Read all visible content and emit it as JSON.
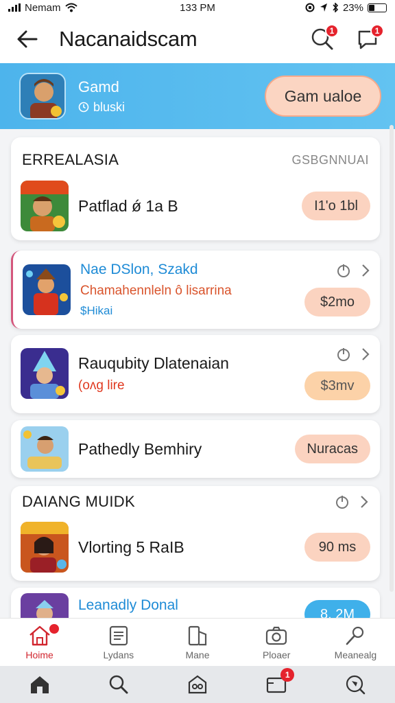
{
  "status": {
    "carrier": "Nemam",
    "time": "133 PM",
    "battery": "23%"
  },
  "header": {
    "title": "Nacanaidscam",
    "search_badge": "1",
    "notify_badge": "1"
  },
  "banner": {
    "title": "Gamd",
    "subtitle": "bluski",
    "button_label": "Gam ualoe"
  },
  "section1": {
    "title": "ERREALASIA",
    "right_label": "GSBGNNUAI"
  },
  "items": [
    {
      "title": "Patflad ǿ 1a B",
      "pill": "I1'o 1bl"
    },
    {
      "title": "Nae DSlon, Szakd",
      "subtitle": "Chamahennleln ô lisarrina",
      "meta": "$Hikai",
      "pill": "$2mo"
    },
    {
      "title": "Rauqubity Dlatenaian",
      "subtitle": "(oʌg lire",
      "pill": "$3mv"
    },
    {
      "title": "Pathedly Bemhiry",
      "pill": "Nuracas"
    }
  ],
  "section2": {
    "title": "DAIANG MUIDK"
  },
  "items2": [
    {
      "title": "Vlorting 5 RaIB",
      "pill": "90 ms"
    },
    {
      "title": "Leanadly Donal",
      "pill": "8. 2M"
    }
  ],
  "tabs": [
    {
      "label": "Hoime",
      "icon": "home-icon"
    },
    {
      "label": "Lydans",
      "icon": "list-icon"
    },
    {
      "label": "Mane",
      "icon": "phone-icon"
    },
    {
      "label": "Ploaer",
      "icon": "camera-icon"
    },
    {
      "label": "Meanealg",
      "icon": "magic-wand-icon"
    }
  ],
  "bottom_bar": {
    "inbox_badge": "1"
  },
  "colors": {
    "accent_red": "#d1262f",
    "banner_blue": "#4db4ec",
    "pill_peach": "#fbd3c0",
    "link_blue": "#1e8bd6"
  }
}
